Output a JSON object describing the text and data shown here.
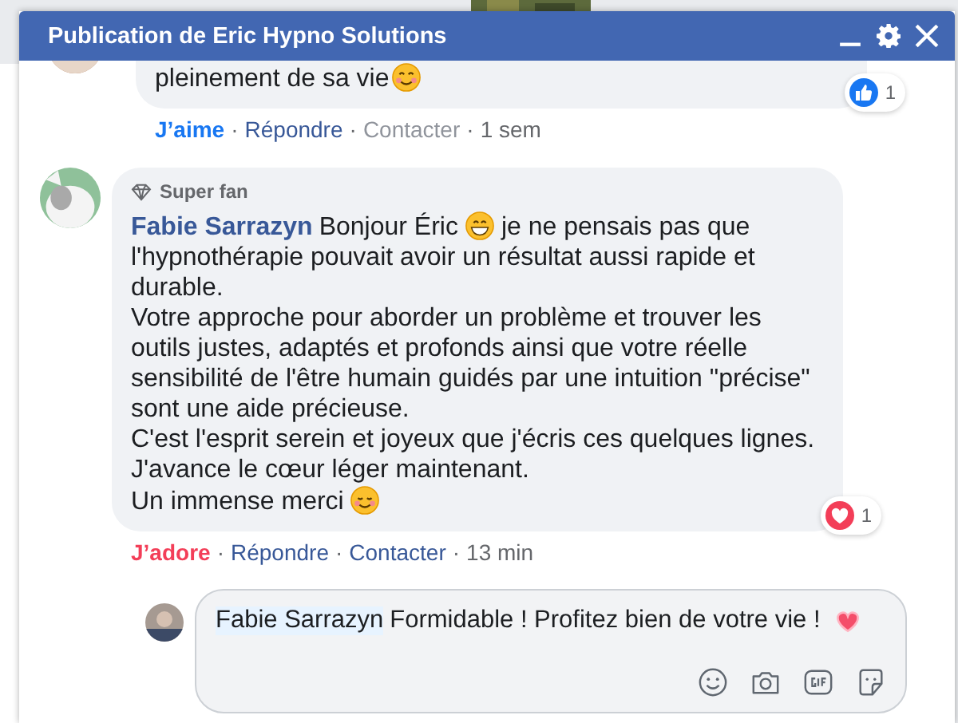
{
  "window": {
    "title": "Publication de Eric Hypno Solutions"
  },
  "separator": "·",
  "comments": [
    {
      "paragraphs": [
        [
          {
            "kind": "text",
            "text": "pleinement de sa vie"
          },
          {
            "kind": "smile"
          }
        ]
      ],
      "reaction": {
        "kind": "like",
        "count": "1"
      },
      "actions": [
        {
          "kind": "like",
          "label": "J’aime"
        },
        {
          "kind": "link",
          "label": "Répondre"
        },
        {
          "kind": "muted",
          "label": "Contacter"
        },
        {
          "kind": "time",
          "label": "1 sem"
        }
      ]
    },
    {
      "badge": "Super fan",
      "name": "Fabie Sarrazyn",
      "paragraphs": [
        [
          {
            "kind": "text",
            "text": "Bonjour Éric"
          },
          {
            "kind": "grin"
          },
          {
            "kind": "text",
            "text": "je ne pensais pas que"
          }
        ],
        [
          {
            "kind": "text",
            "text": "l'hypnothérapie pouvait avoir un résultat aussi rapide et durable."
          }
        ],
        [
          {
            "kind": "text",
            "text": "Votre approche pour aborder un problème et trouver les outils justes, adaptés et profonds ainsi que votre réelle sensibilité de l'être humain guidés par une intuition \"précise\" sont une aide précieuse."
          }
        ],
        [
          {
            "kind": "text",
            "text": "C'est l'esprit serein et joyeux que j'écris ces quelques lignes."
          }
        ],
        [
          {
            "kind": "text",
            "text": "J'avance le cœur léger maintenant."
          }
        ],
        [
          {
            "kind": "text",
            "text": "Un immense merci"
          },
          {
            "kind": "blush"
          }
        ]
      ],
      "reaction": {
        "kind": "love",
        "count": "1"
      },
      "actions": [
        {
          "kind": "love",
          "label": "J’adore"
        },
        {
          "kind": "link",
          "label": "Répondre"
        },
        {
          "kind": "link",
          "label": "Contacter"
        },
        {
          "kind": "time",
          "label": "13 min"
        }
      ]
    }
  ],
  "reply": {
    "parts": [
      {
        "kind": "mention",
        "text": "Fabie Sarrazyn"
      },
      {
        "kind": "text",
        "text": "Formidable ! Profitez bien de votre vie !"
      },
      {
        "kind": "heart"
      }
    ]
  }
}
